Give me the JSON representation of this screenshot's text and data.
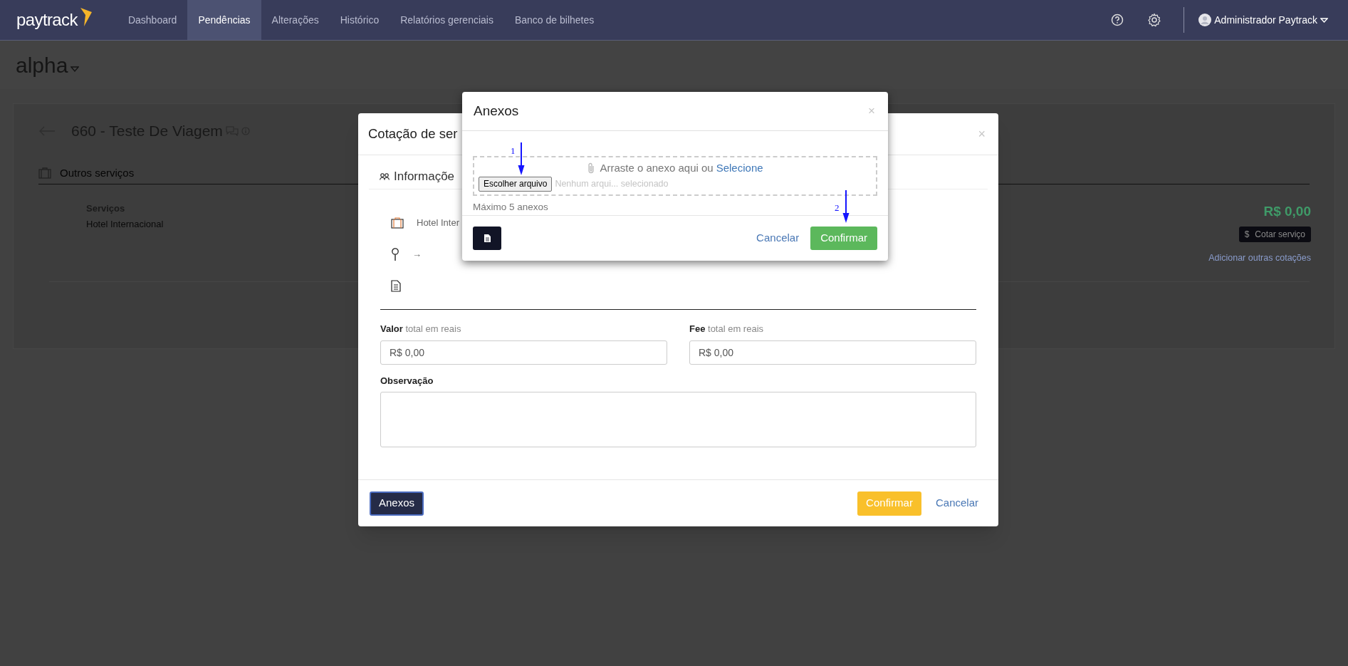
{
  "navbar": {
    "logo": "paytrack",
    "items": [
      {
        "label": "Dashboard",
        "selected": false
      },
      {
        "label": "Pendências",
        "selected": true
      },
      {
        "label": "Alterações",
        "selected": false
      },
      {
        "label": "Histórico",
        "selected": false
      },
      {
        "label": "Relatórios gerenciais",
        "selected": false
      },
      {
        "label": "Banco de bilhetes",
        "selected": false
      }
    ],
    "user": "Administrador Paytrack"
  },
  "page": {
    "title": "alpha",
    "request_title": "660 - Teste De Viagem",
    "section": "Outros serviços",
    "service": {
      "label": "Serviços",
      "value": "Hotel Internacional",
      "price": "R$ 0,00",
      "quote_icon": "$",
      "quote_button": "Cotar serviço",
      "add_link": "Adicionar outras cotações"
    }
  },
  "quote_modal": {
    "title": "Cotação de ser",
    "close": "×",
    "tab": "Informaçõe",
    "details": [
      {
        "kind": "suitcase",
        "text": "Hotel Inter"
      },
      {
        "kind": "pin",
        "text": "→"
      },
      {
        "kind": "document"
      }
    ],
    "fields": [
      {
        "label": "**Valor** total em reais",
        "value": "R$ 0,00"
      },
      {
        "label": "**Fee** total em reais",
        "value": "R$ 0,00"
      }
    ],
    "note_label": "Observação",
    "attachments_button": "Anexos",
    "confirm": "Confirmar",
    "cancel": "Cancelar"
  },
  "attachments_modal": {
    "title": "Anexos",
    "close": "×",
    "drop_text": "Arraste o anexo aqui ou",
    "drop_link": "Selecione",
    "file_button": "Escolher arquivo",
    "file_status": "Nenhum arqui... selecionado",
    "limit": "Máximo 5 anexos",
    "cancel": "Cancelar",
    "confirm": "Confirmar"
  },
  "annotations": [
    {
      "label": "1"
    },
    {
      "label": "2"
    }
  ]
}
